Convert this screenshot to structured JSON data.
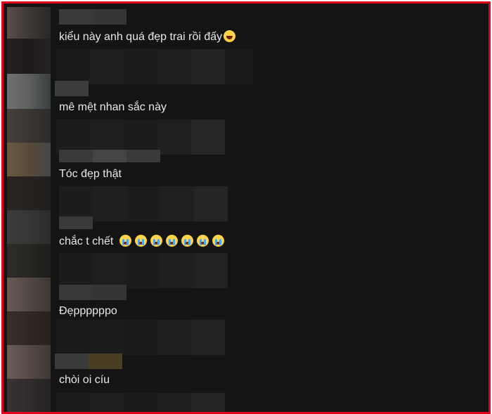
{
  "comments": [
    {
      "text": "kiểu này anh quá đẹp trai rồi đấy",
      "emoji": "rolling-on-floor-laughing-icon"
    },
    {
      "text": "mê mệt nhan sắc này"
    },
    {
      "text": "Tóc đẹp thật"
    },
    {
      "text": "chắc t chết",
      "emoji": "loudly-crying-face-icon",
      "emoji_count": 7
    },
    {
      "text": "Đẹppppppo"
    },
    {
      "text": "chòi oi cíu"
    }
  ],
  "colors": {
    "frame_border": "#e3001b",
    "background": "#141414",
    "text": "#e8e8e8"
  }
}
